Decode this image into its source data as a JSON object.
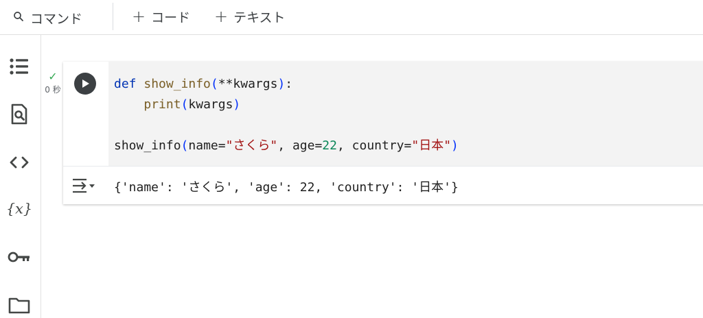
{
  "toolbar": {
    "command_label": "コマンド",
    "add_code_label": "コード",
    "add_text_label": "テキスト",
    "plus_symbol": "+"
  },
  "sidebar": {
    "items": [
      {
        "name": "table-of-contents",
        "icon": "list-icon"
      },
      {
        "name": "find-replace",
        "icon": "document-search-icon"
      },
      {
        "name": "code-snippets",
        "icon": "code-icon"
      },
      {
        "name": "variables",
        "icon": "variables-icon"
      },
      {
        "name": "secrets",
        "icon": "key-icon"
      },
      {
        "name": "files",
        "icon": "folder-icon"
      }
    ]
  },
  "cell": {
    "status_check": "✓",
    "exec_time": "0 秒",
    "code": {
      "line1": {
        "kw": "def",
        "fn": "show_info",
        "open": "(",
        "rest": "**kwargs",
        "close": ")",
        "colon": ":"
      },
      "line2": {
        "indent": "    ",
        "fn": "print",
        "open": "(",
        "arg": "kwargs",
        "close": ")"
      },
      "line4": {
        "fn": "show_info",
        "open": "(",
        "p1": "name=",
        "s1": "\"さくら\"",
        "p2": ", age=",
        "n1": "22",
        "p3": ", country=",
        "s2": "\"日本\"",
        "close": ")"
      }
    },
    "output": "{'name': 'さくら', 'age': 22, 'country': '日本'}"
  },
  "colors": {
    "keyword": "#0033b3",
    "function": "#795e26",
    "string": "#a31515",
    "number": "#098658",
    "run_button": "#3c4043",
    "check": "#34a853"
  }
}
